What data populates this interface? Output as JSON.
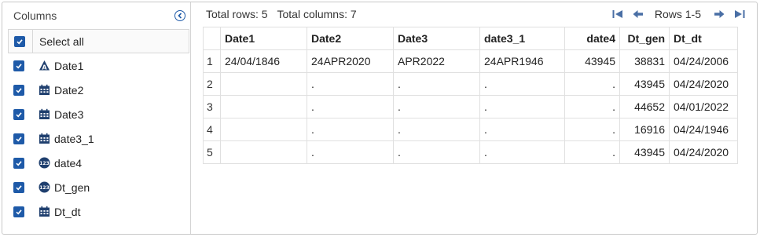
{
  "column_panel": {
    "title": "Columns",
    "select_all_label": "Select all",
    "columns": [
      {
        "label": "Date1",
        "type_icon": "character-type-icon"
      },
      {
        "label": "Date2",
        "type_icon": "calendar-icon"
      },
      {
        "label": "Date3",
        "type_icon": "calendar-icon"
      },
      {
        "label": "date3_1",
        "type_icon": "calendar-icon"
      },
      {
        "label": "date4",
        "type_icon": "numeric-type-icon"
      },
      {
        "label": "Dt_gen",
        "type_icon": "numeric-type-icon"
      },
      {
        "label": "Dt_dt",
        "type_icon": "calendar-icon"
      }
    ]
  },
  "grid": {
    "total_rows_text": "Total rows: 5",
    "total_columns_text": "Total columns: 7",
    "rows_range": "Rows 1-5",
    "headers": [
      "Date1",
      "Date2",
      "Date3",
      "date3_1",
      "date4",
      "Dt_gen",
      "Dt_dt"
    ],
    "rows": [
      {
        "n": "1",
        "cells": [
          "24/04/1846",
          "24APR2020",
          "APR2022",
          "24APR1946",
          "43945",
          "38831",
          "04/24/2006"
        ]
      },
      {
        "n": "2",
        "cells": [
          "",
          ".",
          ".",
          ".",
          ".",
          "43945",
          "04/24/2020"
        ]
      },
      {
        "n": "3",
        "cells": [
          "",
          ".",
          ".",
          ".",
          ".",
          "44652",
          "04/01/2022"
        ]
      },
      {
        "n": "4",
        "cells": [
          "",
          ".",
          ".",
          ".",
          ".",
          "16916",
          "04/24/1946"
        ]
      },
      {
        "n": "5",
        "cells": [
          "",
          ".",
          ".",
          ".",
          ".",
          "43945",
          "04/24/2020"
        ]
      }
    ]
  },
  "colors": {
    "accent": "#1e5aa8",
    "pager_icon": "#4a6fa5",
    "border": "#e0e0e0"
  }
}
